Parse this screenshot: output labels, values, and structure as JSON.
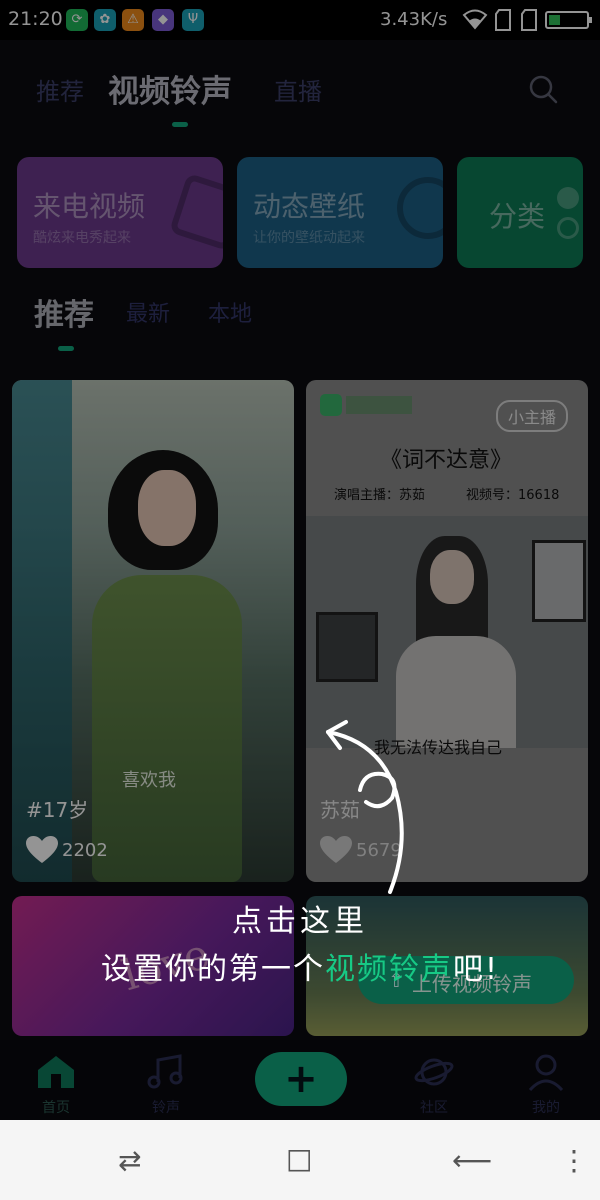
{
  "status_bar": {
    "time": "21:20",
    "speed": "3.43K/s",
    "notification_icons": [
      {
        "name": "app-green-icon",
        "glyph": "⟳",
        "color": "#1fb85a"
      },
      {
        "name": "app-teal-icon",
        "glyph": "✿",
        "color": "#1aa3b8"
      },
      {
        "name": "warning-icon",
        "glyph": "⚠",
        "color": "#f08a1a"
      },
      {
        "name": "app-multicolor-icon",
        "glyph": "◆",
        "color": "#7c5cd6"
      },
      {
        "name": "usb-icon",
        "glyph": "Ψ",
        "color": "#1aa3b8"
      }
    ],
    "battery_color": "#31c15a"
  },
  "header": {
    "tabs": [
      "推荐",
      "视频铃声",
      "直播"
    ],
    "active_tab": "视频铃声",
    "accent": "#12a57c"
  },
  "cards": [
    {
      "title": "来电视频",
      "subtitle": "酷炫来电秀起来",
      "color": "#7b3fa0"
    },
    {
      "title": "动态壁纸",
      "subtitle": "让你的壁纸动起来",
      "color": "#1f6f9a"
    },
    {
      "title": "分类",
      "subtitle": "",
      "color": "#0f8a5e"
    }
  ],
  "sub_tabs": [
    "推荐",
    "最新",
    "本地"
  ],
  "active_sub_tab": "推荐",
  "feed": [
    {
      "caption": "#17岁",
      "likes": "2202",
      "watermark": "喜欢我"
    },
    {
      "caption": "苏茹",
      "likes": "5679",
      "brand_badge": "小主播",
      "song_title": "《词不达意》",
      "singer_label": "演唱主播：苏茹",
      "video_label": "视频号：16618",
      "lyric": "我无法传达我自己"
    },
    {
      "caption": "",
      "likes": "",
      "art_text": "love"
    },
    {
      "caption": "",
      "likes": "",
      "upload_label": "上传视频铃声"
    }
  ],
  "overlay": {
    "line1": "点击这里",
    "line2_prefix": "设置你的第一个",
    "line2_highlight": "视频铃声",
    "line2_suffix": "吧!"
  },
  "bottom_nav": {
    "items": [
      "首页",
      "铃声",
      "社区",
      "我的"
    ],
    "plus_symbol": "+"
  },
  "system_nav": {
    "switch_glyph": "⇄",
    "home_glyph": "□",
    "back_glyph": "⟵",
    "menu_glyph": "⋮"
  }
}
